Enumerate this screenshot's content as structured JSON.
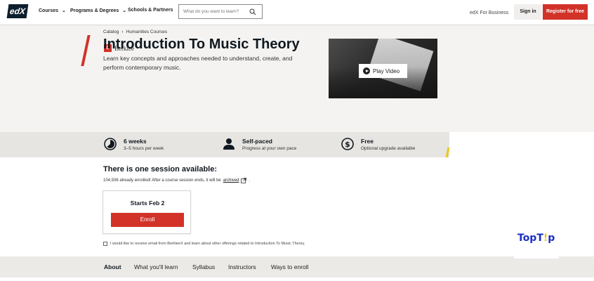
{
  "header": {
    "logo": "edX",
    "nav": [
      "Courses",
      "Programs & Degrees",
      "Schools & Partners"
    ],
    "search_placeholder": "What do you want to learn?",
    "business": "edX For Business",
    "signin": "Sign in",
    "register": "Register for free"
  },
  "breadcrumb": [
    "Catalog",
    "Humanities Courses"
  ],
  "school": "Berklee",
  "course": {
    "title": "Introduction To Music Theory",
    "description": "Learn key concepts and approaches needed to understand, create, and perform contemporary music.",
    "video_label": "Play Video"
  },
  "stats": [
    {
      "title": "6 weeks",
      "sub": "3–5 hours per week",
      "icon": "clock-icon"
    },
    {
      "title": "Self-paced",
      "sub": "Progress at your own pace",
      "icon": "person-icon"
    },
    {
      "title": "Free",
      "sub": "Optional upgrade available",
      "icon": "dollar-icon"
    }
  ],
  "session": {
    "heading": "There is one session available:",
    "info": "104,936 already enrolled! After a course session ends, it will be",
    "archived": "archived",
    "starts": "Starts Feb 2",
    "enroll": "Enroll"
  },
  "consent": "I would like to receive email from BerkleeX and learn about other offerings related to Introduction To Music Theory.",
  "tabs": [
    "About",
    "What you'll learn",
    "Syllabus",
    "Instructors",
    "Ways to enroll"
  ],
  "watermark": "TopTip",
  "colors": {
    "accent": "#d23228",
    "brand_dark": "#0d1f2d",
    "highlight": "#f0c419"
  }
}
